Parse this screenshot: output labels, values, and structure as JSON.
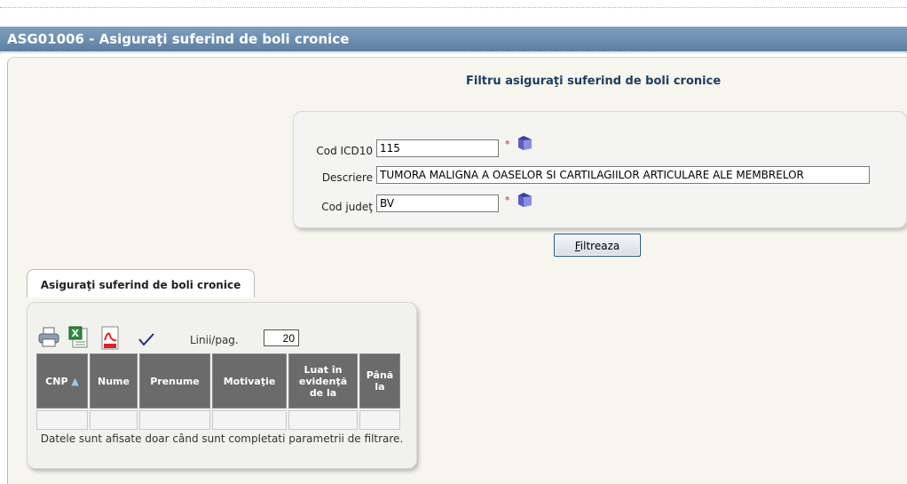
{
  "window": {
    "title": "ASG01006 - Asiguraţi suferind de boli cronice"
  },
  "filter": {
    "title": "Filtru asiguraţi suferind de boli cronice",
    "cod_icd10": {
      "label": "Cod ICD10",
      "value": "115"
    },
    "descriere": {
      "label": "Descriere",
      "value": "TUMORA MALIGNA A OASELOR SI CARTILAGIILOR ARTICULARE ALE MEMBRELOR"
    },
    "cod_judet": {
      "label": "Cod judeţ",
      "value": "BV"
    },
    "required_mark": "*",
    "button": {
      "label": "Filtreaza",
      "accesskey": "F"
    }
  },
  "results": {
    "tab_label": "Asiguraţi suferind de boli cronice",
    "toolbar": {
      "icons": [
        "printer-icon",
        "excel-icon",
        "pdf-icon",
        "checkmark-icon"
      ]
    },
    "rows_per_page": {
      "label": "Linii/pag.",
      "value": "20"
    },
    "columns": [
      "CNP",
      "Nume",
      "Prenume",
      "Motivaţie",
      "Luat în evidenţă de la",
      "Până la"
    ],
    "sort_column": "CNP",
    "note": "Datele sunt afisate doar când sunt completati parametrii de filtrare."
  },
  "colors": {
    "titlebar": "#6b8db3",
    "header": "#1c3e63",
    "grid_header": "#6b6b6b",
    "required": "#c82020"
  }
}
